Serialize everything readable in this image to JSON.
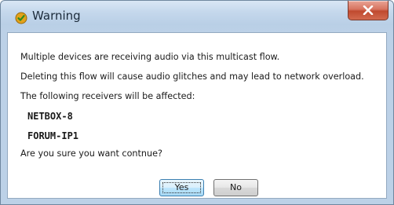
{
  "window": {
    "title": "Warning",
    "title_icon": "warning-shield-icon",
    "close_icon": "close-icon"
  },
  "message": {
    "line1": "Multiple devices are receiving audio via this multicast flow.",
    "line2": "Deleting this flow will cause audio glitches and may lead to network overload.",
    "line3": "The following receivers will be affected:",
    "receivers": [
      "NETBOX-8",
      "FORUM-IP1"
    ],
    "question": "Are you sure you want contnue?"
  },
  "buttons": {
    "yes": "Yes",
    "no": "No"
  },
  "colors": {
    "title_bar": "#c5d8ec",
    "close_button": "#c04a2f",
    "default_button_border": "#3c7fb1"
  }
}
